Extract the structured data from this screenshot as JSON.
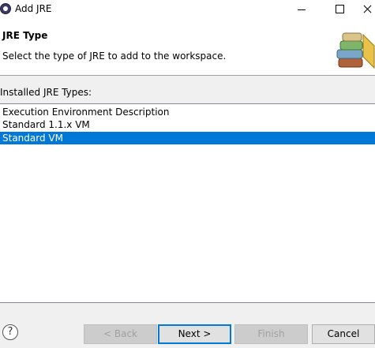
{
  "window": {
    "title": "Add JRE",
    "icon": "eclipse-icon"
  },
  "header": {
    "title": "JRE Type",
    "description": "Select the type of JRE to add to the workspace.",
    "logo_icon": "jre-books-icon"
  },
  "list": {
    "label": "Installed JRE Types:",
    "items": [
      {
        "label": "Execution Environment Description",
        "selected": false
      },
      {
        "label": "Standard 1.1.x VM",
        "selected": false
      },
      {
        "label": "Standard VM",
        "selected": true
      }
    ]
  },
  "buttons": {
    "help": "?",
    "back": "< Back",
    "next": "Next >",
    "finish": "Finish",
    "cancel": "Cancel"
  },
  "colors": {
    "selection": "#0078d7",
    "default_button_border": "#0078d7"
  }
}
